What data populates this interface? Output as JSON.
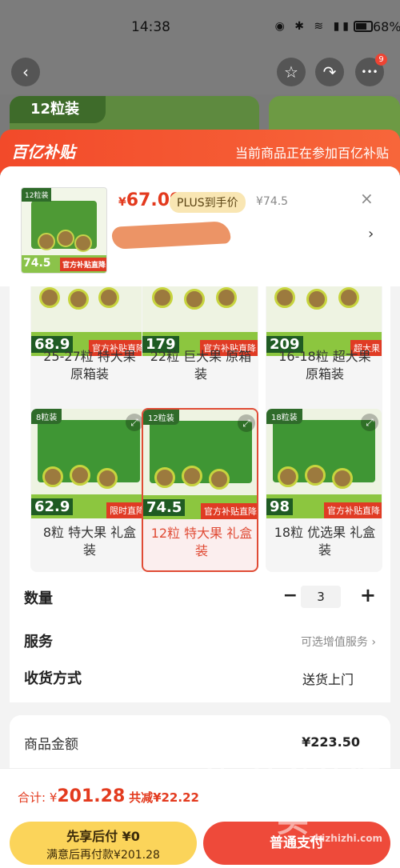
{
  "status": {
    "time": "14:38",
    "battery": "68%",
    "icons": "◉ ✱ ≋ ▮▮"
  },
  "nav": {
    "back": "‹",
    "fav": "☆",
    "share": "↷",
    "more": "•••",
    "badge": "9"
  },
  "bg": {
    "tag": "12粒装"
  },
  "banner": {
    "logo": "百亿补贴",
    "note": "当前商品正在参加百亿补贴"
  },
  "product": {
    "thumb_label": "12粒装",
    "thumb_price": "74.5",
    "thumb_tag": "官方补贴直降",
    "currency": "¥",
    "price": "67.09",
    "plus_label": "PLUS到手价",
    "orig_price": "¥74.5",
    "close": "×",
    "more": "›"
  },
  "options": [
    {
      "name": "25-27粒 特大果 原箱装",
      "price": "68.9",
      "tag": "官方补贴直降",
      "corner": ""
    },
    {
      "name": "22粒 巨大果 原箱装",
      "price": "179",
      "tag": "官方补贴直降",
      "corner": ""
    },
    {
      "name": "16-18粒 超大果 原箱装",
      "price": "209",
      "tag": "超大果",
      "corner": ""
    },
    {
      "name": "8粒 特大果 礼盒装",
      "price": "62.9",
      "tag": "限时直降",
      "corner": "8粒装"
    },
    {
      "name": "12粒 特大果 礼盒装",
      "price": "74.5",
      "tag": "官方补贴直降",
      "corner": "12粒装"
    },
    {
      "name": "18粒 优选果 礼盒装",
      "price": "98",
      "tag": "官方补贴直降",
      "corner": "18粒装"
    }
  ],
  "settings": {
    "qty_label": "数量",
    "qty": "3",
    "minus": "−",
    "plus": "+",
    "service_label": "服务",
    "service_value": "可选增值服务 ›",
    "delivery_label": "收货方式",
    "delivery_value": "送货上门"
  },
  "amount": {
    "label": "商品金额",
    "value": "¥223.50"
  },
  "footer": {
    "total_prefix": "合计: ¥",
    "total_value": "201.28",
    "saving": "共减¥22.22",
    "btn_left_title": "先享后付 ¥0",
    "btn_left_sub": "满意后再付款¥201.28",
    "btn_right": "普通支付",
    "watermark": "值 什么值得买",
    "watermark_url": "zhizhizhi.com"
  },
  "colors": {
    "accent": "#e33a1e",
    "banner": "#f24a2a",
    "button_left": "#fbd45a",
    "button_right": "#ee4a3a"
  }
}
